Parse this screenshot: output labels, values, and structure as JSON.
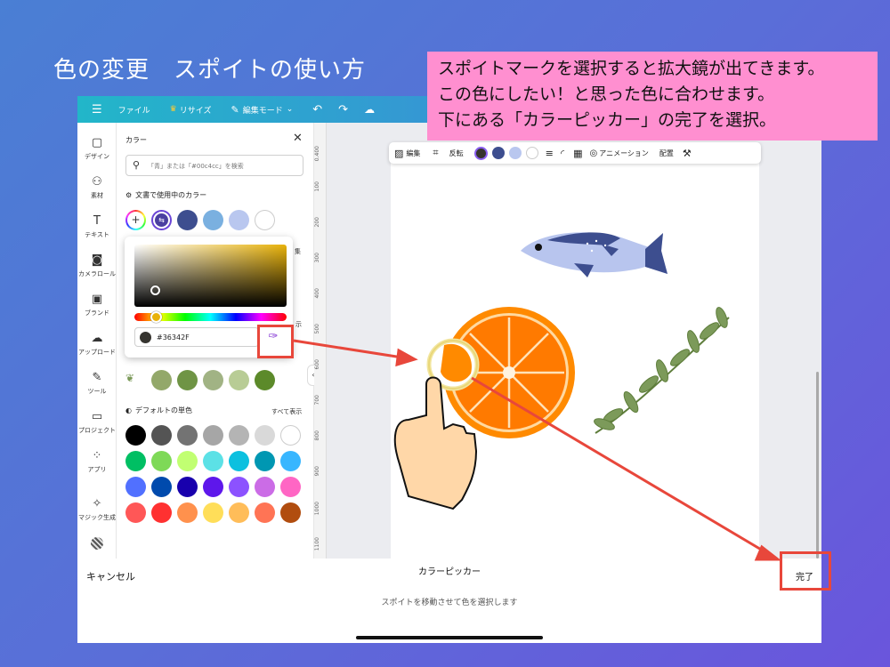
{
  "slide": {
    "title": "色の変更　スポイトの使い方",
    "callout_lines": [
      "スポイトマークを選択すると拡大鏡が出てきます。",
      "この色にしたい！と思った色に合わせます。",
      "下にある「カラーピッカー」の完了を選択。"
    ]
  },
  "topbar": {
    "file": "ファイル",
    "resize": "リサイズ",
    "edit_mode": "編集モード"
  },
  "rail": [
    {
      "label": "デザイン",
      "icon": "layout-icon"
    },
    {
      "label": "素材",
      "icon": "elements-icon"
    },
    {
      "label": "テキスト",
      "icon": "text-icon"
    },
    {
      "label": "カメラロール",
      "icon": "camera-icon"
    },
    {
      "label": "ブランド",
      "icon": "brand-icon"
    },
    {
      "label": "アップロード",
      "icon": "upload-icon"
    },
    {
      "label": "ツール",
      "icon": "pen-icon"
    },
    {
      "label": "プロジェクト",
      "icon": "folder-icon"
    },
    {
      "label": "アプリ",
      "icon": "apps-icon"
    },
    {
      "label": "マジック生成",
      "icon": "magic-icon"
    }
  ],
  "panel": {
    "title": "カラー",
    "search_placeholder": "「青」または「#00c4cc」を検索",
    "doc_colors_heading": "文書で使用中のカラー",
    "doc_colors": [
      "#3d4e8f",
      "#7ab0e0",
      "#b9c7ef",
      "#ffffff"
    ],
    "hidden_right_1": "集",
    "hidden_right_2": "示",
    "photo_colors": [
      "#93a86a",
      "#6f9445",
      "#a1b384",
      "#b8cc95",
      "#5c8a2a"
    ],
    "default_heading": "デフォルトの単色",
    "show_all": "すべて表示",
    "default_colors": [
      [
        "#000000",
        "#545454",
        "#737373",
        "#a6a6a6",
        "#b4b4b4",
        "#d9d9d9",
        "#ffffff"
      ],
      [
        "#00bf63",
        "#7ed957",
        "#c1ff72",
        "#5ce1e6",
        "#0cc0df",
        "#0097b2",
        "#38b6ff"
      ],
      [
        "#5170ff",
        "#004aad",
        "#1800ad",
        "#5e17eb",
        "#8c52ff",
        "#cb6ce6",
        "#ff66c4"
      ],
      [
        "#ff5757",
        "#ff3131",
        "#ff914d",
        "#ffde59",
        "#ffbd59",
        "#ff7455",
        "#b14d0f"
      ]
    ]
  },
  "picker": {
    "hex": "#36342F",
    "swatch": "#36342F",
    "hue_value": 0.14
  },
  "ruler_ticks": [
    "0.400",
    "100",
    "200",
    "300",
    "400",
    "500",
    "600",
    "700",
    "800",
    "900",
    "1000",
    "1100"
  ],
  "canvas_toolbar": {
    "edit": "編集",
    "flip": "反転",
    "colors": [
      "#36342f",
      "#3d4e8f",
      "#b9c7ef",
      "#ffffff"
    ],
    "animation": "アニメーション",
    "position": "配置"
  },
  "bottom": {
    "cancel": "キャンセル",
    "title": "カラーピッカー",
    "done": "完了",
    "hint": "スポイトを移動させて色を選択します"
  }
}
